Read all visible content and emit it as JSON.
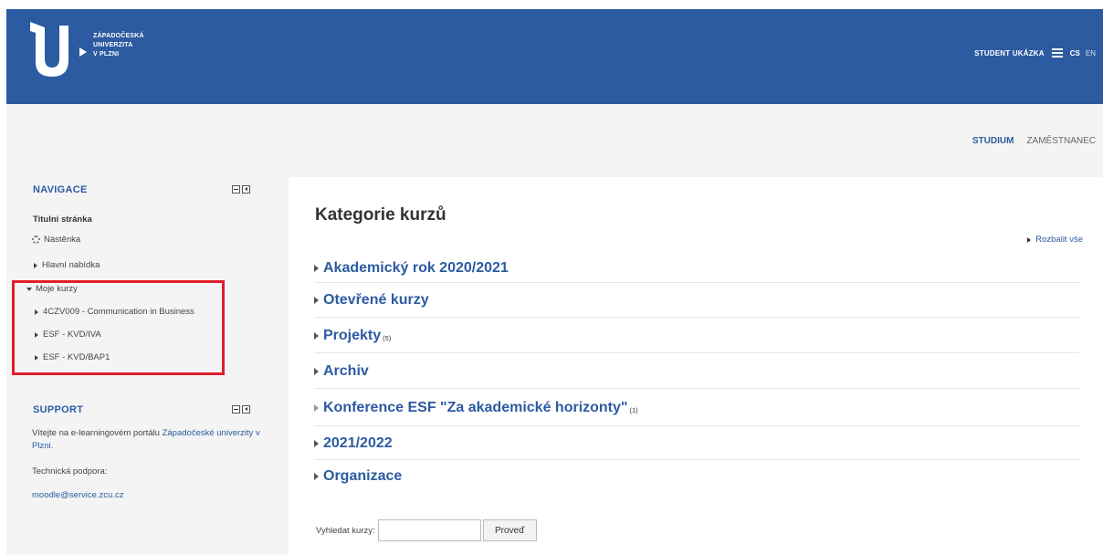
{
  "header": {
    "logo_lines": [
      "ZÁPADOČESKÁ",
      "UNIVERZITA",
      "V PLZNI"
    ],
    "user_name": "STUDENT UKÁZKA",
    "lang_active": "CS",
    "lang_other": "EN",
    "background_color": "#2c5ba1"
  },
  "roles": {
    "active": "STUDIUM",
    "other": "ZAMĚSTNANEC"
  },
  "navigation": {
    "title": "NAVIGACE",
    "home": "Titulní stránka",
    "dashboard": "Nástěnka",
    "main_menu": "Hlavní nabídka",
    "my_courses": "Moje kurzy",
    "courses": [
      "4CZV009 - Communication in Business",
      "ESF - KVD/IVA",
      "ESF - KVD/BAP1"
    ]
  },
  "support": {
    "title": "SUPPORT",
    "welcome_prefix": "Vítejte na e-learningovém portálu ",
    "welcome_link": "Západočeské univerzity v Plzni",
    "welcome_suffix": ".",
    "tech_label": "Technická podpora:",
    "email": "moodle@service.zcu.cz"
  },
  "main": {
    "title": "Kategorie kurzů",
    "expand_all": "Rozbalit vše",
    "categories": [
      {
        "name": "Akademický rok 2020/2021",
        "count": ""
      },
      {
        "name": "Otevřené kurzy",
        "count": ""
      },
      {
        "name": "Projekty",
        "count": "(5)"
      },
      {
        "name": "Archiv",
        "count": ""
      },
      {
        "name": "Konference ESF \"Za akademické horizonty\"",
        "count": "(1)"
      },
      {
        "name": "2021/2022",
        "count": ""
      },
      {
        "name": "Organizace",
        "count": ""
      }
    ],
    "search_label": "Vyhledat kurzy:",
    "search_value": "",
    "search_button": "Proveď"
  },
  "colors": {
    "accent": "#2c5ba1",
    "highlight": "#e01e2b"
  }
}
